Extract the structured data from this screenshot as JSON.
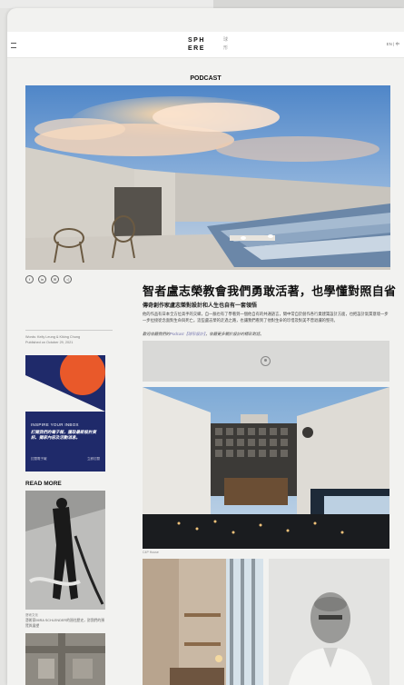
{
  "header": {
    "logo_line1": "SPH",
    "logo_line2": "ERE",
    "logo_sub": "球\n形",
    "lang": "EN | 中"
  },
  "section_title": "PODCAST",
  "article": {
    "title": "智者盧志榮教會我們勇敢活著，也學懂對照自省",
    "subtitle": "傳奇創作家盧志榮對設計和人生也自有一套領悟",
    "body": "他的作品有日本全方位高手的交織，自一脈也有了學看到一個他自有的共通語言，間中常自於創作各行業建築設計方面，也把設計氣質意境一步一步拉接從念面對生命與死亡。這些盧志榮的走過之路，也讓我們看到了他對生命的珍惜及對美不曾退讓的堅持。",
    "note_prefix": "歡迎收聽我們的",
    "note_link": "Podcast【球形設計】",
    "note_suffix": "，收聽更多關於設計的精彩對話。",
    "image_caption": "C4P House",
    "share_icons": [
      "facebook-icon",
      "linkedin-icon",
      "email-icon",
      "share-icon"
    ]
  },
  "byline": {
    "author": "Words: Kelly Leung & Kiking Chung",
    "date": "Published on October 29, 2021"
  },
  "ad": {
    "headline": "INSPIRE YOUR INBOX",
    "body": "訂閱我們的電子報，獲取最新設計資訊、獨家內容及活動消息。",
    "footer_left": "訂閱電子報",
    "footer_right": "立即訂閱",
    "colors": {
      "background": "#1f2a6a",
      "sun": "#e9592a"
    }
  },
  "read_more": {
    "heading": "READ MORE",
    "item_category": "藝術文化",
    "item_title": "藝術家MIRA SCHLENDER的過往歷史，對我們的預覽與展望"
  }
}
